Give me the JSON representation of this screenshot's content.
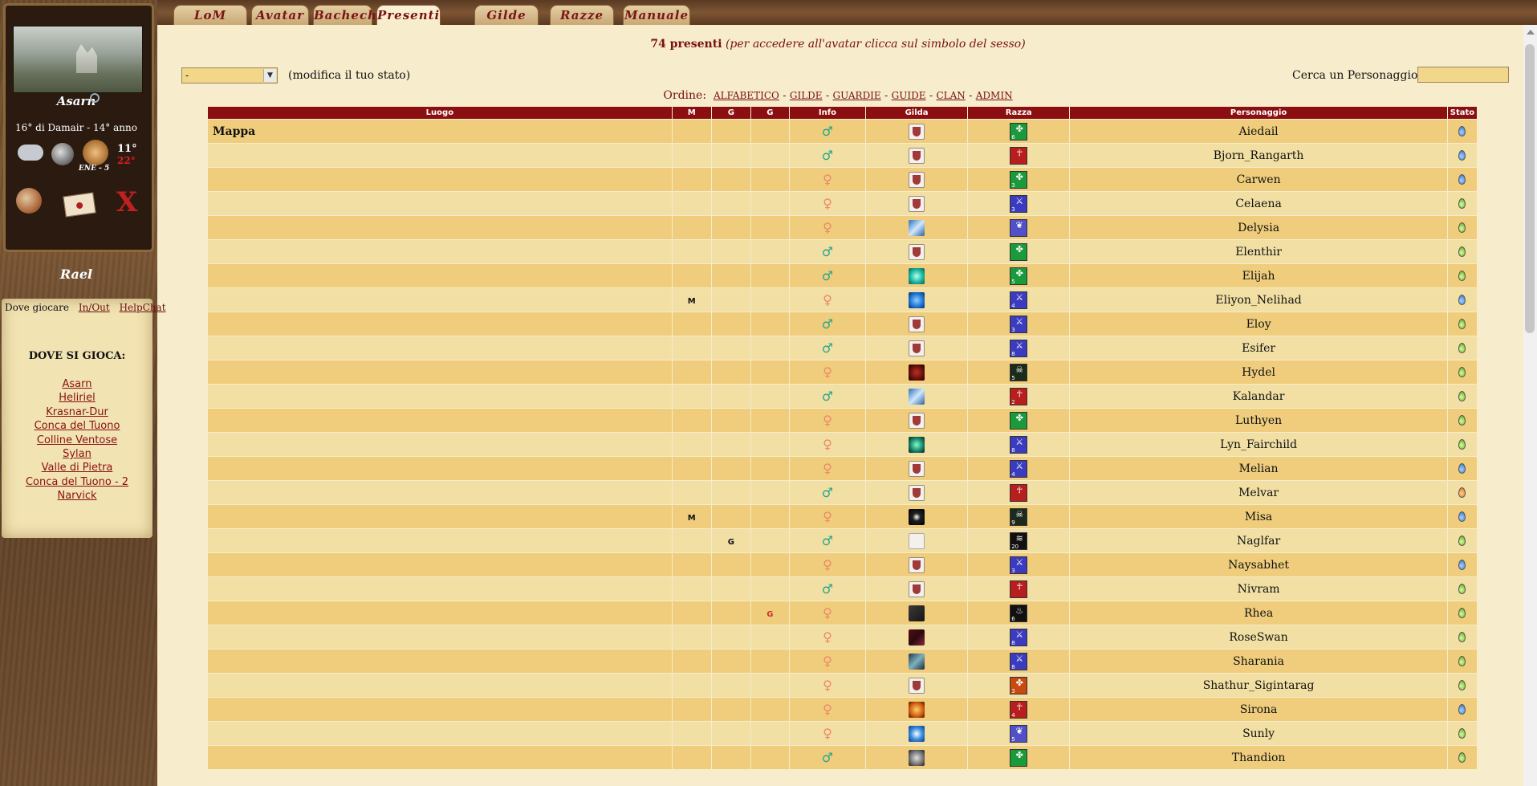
{
  "sidebar": {
    "city": "Asarn",
    "date": "16° di Damair - 14° anno",
    "wind": "ENE - 5",
    "temp_high": "11°",
    "temp_low": "22°",
    "user": "Rael",
    "panel_tabs": [
      "Dove giocare",
      "In/Out",
      "HelpChat"
    ],
    "panel_title": "DOVE SI GIOCA:",
    "locations": [
      "Asarn",
      "Heliriel",
      "Krasnar-Dur",
      "Conca del Tuono",
      "Colline Ventose",
      "Sylan",
      "Valle di Pietra",
      "Conca del Tuono - 2",
      "Narvick"
    ]
  },
  "tabs": [
    "LoM",
    "Avatar",
    "Bacheche",
    "Presenti",
    "Gilde",
    "Razze",
    "Manuale"
  ],
  "header": {
    "count": "74 presenti",
    "hint": "(per accedere all'avatar clicca sul simbolo del sesso)",
    "status_value": "-",
    "status_label": "(modifica il tuo stato)",
    "search_label": "Cerca un Personaggio:",
    "order_label": "Ordine:",
    "order_links": [
      "ALFABETICO",
      "GILDE",
      "GUARDIE",
      "GUIDE",
      "CLAN",
      "ADMIN"
    ]
  },
  "table": {
    "columns": [
      "Luogo",
      "M",
      "G",
      "G",
      "Info",
      "Gilda",
      "Razza",
      "Personaggio",
      "Stato"
    ],
    "rows": [
      {
        "luogo": "Mappa",
        "m": "",
        "g1": "",
        "g2": "",
        "sex": "♂",
        "gilda": "shield",
        "razza": "green",
        "race_sym": "✤",
        "race_lvl": "6",
        "name": "Aiedail",
        "stato": "blue"
      },
      {
        "luogo": "",
        "m": "",
        "g1": "",
        "g2": "",
        "sex": "♂",
        "gilda": "shield",
        "razza": "red",
        "race_sym": "☥",
        "race_lvl": "",
        "name": "Bjorn_Rangarth",
        "stato": "blue"
      },
      {
        "luogo": "",
        "m": "",
        "g1": "",
        "g2": "",
        "sex": "♀",
        "gilda": "shield",
        "razza": "green",
        "race_sym": "✤",
        "race_lvl": "3",
        "name": "Carwen",
        "stato": "blue"
      },
      {
        "luogo": "",
        "m": "",
        "g1": "",
        "g2": "",
        "sex": "♀",
        "gilda": "shield",
        "razza": "blue",
        "race_sym": "⚔",
        "race_lvl": "3",
        "name": "Celaena",
        "stato": "green"
      },
      {
        "luogo": "",
        "m": "",
        "g1": "",
        "g2": "",
        "sex": "♀",
        "gilda": "ice",
        "razza": "purple",
        "race_sym": "❦",
        "race_lvl": "",
        "name": "Delysia",
        "stato": "green"
      },
      {
        "luogo": "",
        "m": "",
        "g1": "",
        "g2": "",
        "sex": "♂",
        "gilda": "shield",
        "razza": "green",
        "race_sym": "✤",
        "race_lvl": "",
        "name": "Elenthir",
        "stato": "green"
      },
      {
        "luogo": "",
        "m": "",
        "g1": "",
        "g2": "",
        "sex": "♂",
        "gilda": "orb",
        "razza": "green",
        "race_sym": "✤",
        "race_lvl": "5",
        "name": "Elijah",
        "stato": "green"
      },
      {
        "luogo": "",
        "m": "M",
        "g1": "",
        "g2": "",
        "sex": "♀",
        "gilda": "swirl",
        "razza": "blue",
        "race_sym": "⚔",
        "race_lvl": "4",
        "name": "Eliyon_Nelihad",
        "stato": "blue"
      },
      {
        "luogo": "",
        "m": "",
        "g1": "",
        "g2": "",
        "sex": "♂",
        "gilda": "shield",
        "razza": "blue",
        "race_sym": "⚔",
        "race_lvl": "3",
        "name": "Eloy",
        "stato": "green"
      },
      {
        "luogo": "",
        "m": "",
        "g1": "",
        "g2": "",
        "sex": "♂",
        "gilda": "shield",
        "razza": "blue",
        "race_sym": "⚔",
        "race_lvl": "8",
        "name": "Esifer",
        "stato": "green"
      },
      {
        "luogo": "",
        "m": "",
        "g1": "",
        "g2": "",
        "sex": "♀",
        "gilda": "dark-red",
        "razza": "dark",
        "race_sym": "☠",
        "race_lvl": "5",
        "name": "Hydel",
        "stato": "green"
      },
      {
        "luogo": "",
        "m": "",
        "g1": "",
        "g2": "",
        "sex": "♂",
        "gilda": "ice",
        "razza": "red",
        "race_sym": "☥",
        "race_lvl": "2",
        "name": "Kalandar",
        "stato": "green"
      },
      {
        "luogo": "",
        "m": "",
        "g1": "",
        "g2": "",
        "sex": "♀",
        "gilda": "shield",
        "razza": "green",
        "race_sym": "✤",
        "race_lvl": "",
        "name": "Luthyen",
        "stato": "green"
      },
      {
        "luogo": "",
        "m": "",
        "g1": "",
        "g2": "",
        "sex": "♀",
        "gilda": "green-glow",
        "razza": "blue",
        "race_sym": "⚔",
        "race_lvl": "8",
        "name": "Lyn_Fairchild",
        "stato": "green"
      },
      {
        "luogo": "",
        "m": "",
        "g1": "",
        "g2": "",
        "sex": "♀",
        "gilda": "shield",
        "razza": "blue",
        "race_sym": "⚔",
        "race_lvl": "4",
        "name": "Melian",
        "stato": "blue"
      },
      {
        "luogo": "",
        "m": "",
        "g1": "",
        "g2": "",
        "sex": "♂",
        "gilda": "shield",
        "razza": "red",
        "race_sym": "☥",
        "race_lvl": "",
        "name": "Melvar",
        "stato": "orange"
      },
      {
        "luogo": "",
        "m": "M",
        "g1": "",
        "g2": "",
        "sex": "♀",
        "gilda": "star",
        "razza": "dark",
        "race_sym": "☠",
        "race_lvl": "9",
        "name": "Misa",
        "stato": "blue"
      },
      {
        "luogo": "",
        "m": "",
        "g1": "G",
        "g2": "",
        "sex": "♂",
        "gilda": "fleur",
        "razza": "black",
        "race_sym": "≋",
        "race_lvl": "20",
        "name": "Naglfar",
        "stato": "green"
      },
      {
        "luogo": "",
        "m": "",
        "g1": "",
        "g2": "",
        "sex": "♀",
        "gilda": "shield",
        "razza": "blue",
        "race_sym": "⚔",
        "race_lvl": "3",
        "name": "Naysabhet",
        "stato": "blue"
      },
      {
        "luogo": "",
        "m": "",
        "g1": "",
        "g2": "",
        "sex": "♂",
        "gilda": "shield",
        "razza": "red",
        "race_sym": "☥",
        "race_lvl": "",
        "name": "Nivram",
        "stato": "green"
      },
      {
        "luogo": "",
        "m": "",
        "g1": "",
        "g2": "G",
        "sex": "♀",
        "gilda": "black",
        "razza": "black",
        "race_sym": "♨",
        "race_lvl": "6",
        "name": "Rhea",
        "stato": "green"
      },
      {
        "luogo": "",
        "m": "",
        "g1": "",
        "g2": "",
        "sex": "♀",
        "gilda": "crimson",
        "razza": "blue",
        "race_sym": "⚔",
        "race_lvl": "8",
        "name": "RoseSwan",
        "stato": "green"
      },
      {
        "luogo": "",
        "m": "",
        "g1": "",
        "g2": "",
        "sex": "♀",
        "gilda": "knight",
        "razza": "blue",
        "race_sym": "⚔",
        "race_lvl": "8",
        "name": "Sharania",
        "stato": "green"
      },
      {
        "luogo": "",
        "m": "",
        "g1": "",
        "g2": "",
        "sex": "♀",
        "gilda": "shield",
        "razza": "orange",
        "race_sym": "✤",
        "race_lvl": "3",
        "name": "Shathur_Sigintarag",
        "stato": "green"
      },
      {
        "luogo": "",
        "m": "",
        "g1": "",
        "g2": "",
        "sex": "♀",
        "gilda": "fire",
        "razza": "red",
        "race_sym": "☥",
        "race_lvl": "4",
        "name": "Sirona",
        "stato": "blue"
      },
      {
        "luogo": "",
        "m": "",
        "g1": "",
        "g2": "",
        "sex": "♀",
        "gilda": "wave",
        "razza": "purple",
        "race_sym": "❦",
        "race_lvl": "5",
        "name": "Sunly",
        "stato": "green"
      },
      {
        "luogo": "",
        "m": "",
        "g1": "",
        "g2": "",
        "sex": "♂",
        "gilda": "skull",
        "razza": "green",
        "race_sym": "✤",
        "race_lvl": "",
        "name": "Thandion",
        "stato": "green"
      }
    ]
  }
}
